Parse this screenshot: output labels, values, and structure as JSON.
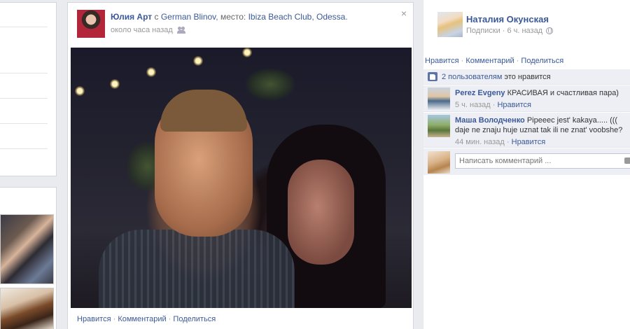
{
  "post": {
    "author": "Юлия Арт",
    "with_word": " с ",
    "tagged": "German Blinov",
    "place_prefix": ", место: ",
    "place": "Ibiza Beach Club, Odessa",
    "place_suffix": ".",
    "time": "около часа назад",
    "close_label": "×",
    "actions": {
      "like": "Нравится",
      "comment": "Комментарий",
      "share": "Поделиться",
      "separator": " · "
    }
  },
  "side": {
    "name": "Наталия Окунская",
    "meta_subscriptions": "Подписки",
    "meta_sep": " · ",
    "meta_time": "6 ч. назад",
    "actions": {
      "like": "Нравится",
      "comment": "Комментарий",
      "share": "Поделиться",
      "separator": " · "
    },
    "likes_link": "2 пользователям",
    "likes_text": " это нравится",
    "comments": [
      {
        "author": "Perez Evgeny",
        "text": " КРАСИВАЯ и счастливая пара)",
        "time": "5 ч. назад",
        "sep": " · ",
        "like": "Нравится"
      },
      {
        "author": "Маша Володченко",
        "text": " Pipeeec jest' kakaya..... ((( daje ne znaju huje uznat tak ili ne znat' voobshe?",
        "time": "44 мин. назад",
        "sep": " · ",
        "like": "Нравится"
      }
    ],
    "write_placeholder": "Написать комментарий ..."
  },
  "icons": {
    "audience": "people-icon",
    "privacy": "globe-icon",
    "likes": "thumbs-up-icon",
    "attach": "camera-icon"
  },
  "colors": {
    "link": "#3b5998",
    "background": "#e9ebee",
    "comment_bg": "#edeff4"
  }
}
